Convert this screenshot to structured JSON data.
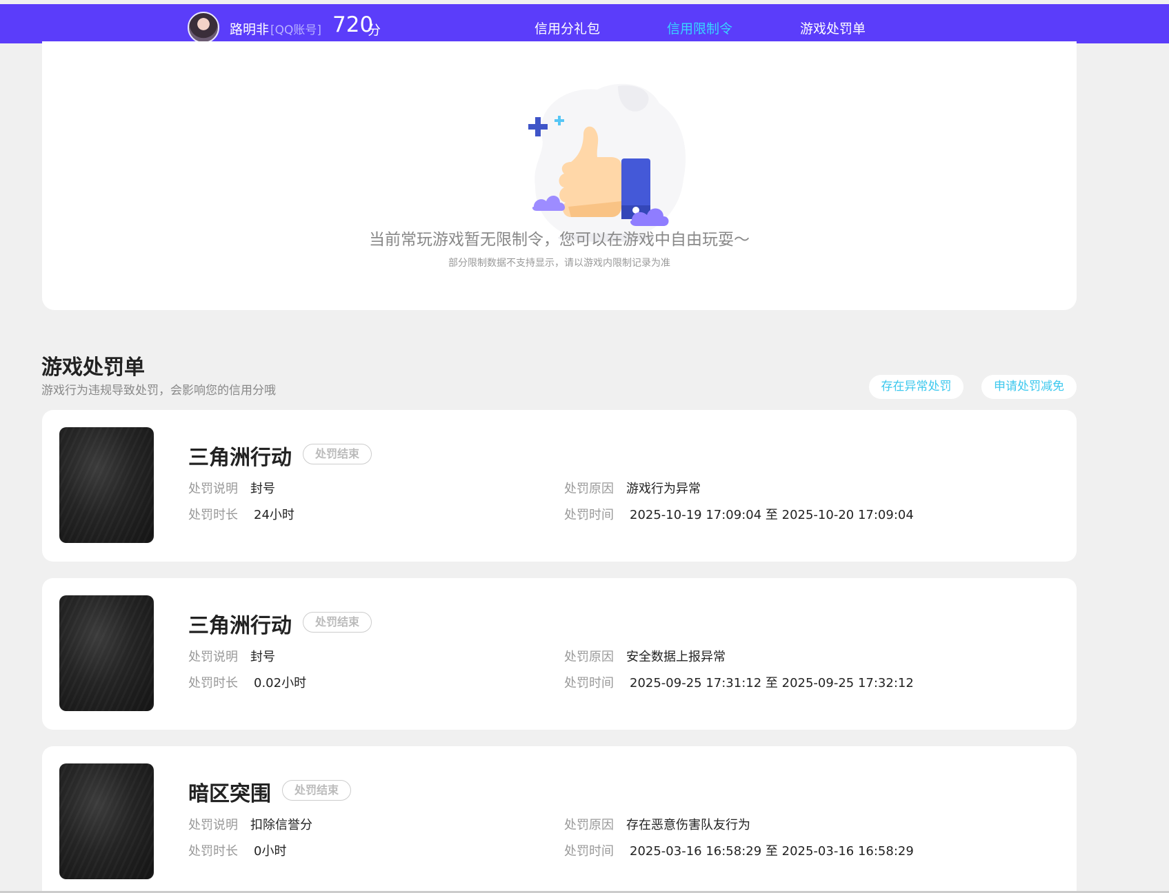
{
  "header": {
    "user_name": "路明非",
    "account_type": "[QQ账号]",
    "score": "720",
    "score_unit": "分",
    "nav": [
      {
        "label": "信用分礼包",
        "active": false
      },
      {
        "label": "信用限制令",
        "active": true
      },
      {
        "label": "游戏处罚单",
        "active": false
      }
    ]
  },
  "restriction": {
    "title": "当前常玩游戏暂无限制令，您可以在游戏中自由玩耍～",
    "subtitle": "部分限制数据不支持显示，请以游戏内限制记录为准"
  },
  "penalty_section": {
    "title": "游戏处罚单",
    "subtitle": "游戏行为违规导致处罚，会影响您的信用分哦",
    "btn_abnormal": "存在异常处罚",
    "btn_appeal": "申请处罚减免"
  },
  "labels": {
    "desc": "处罚说明",
    "duration": "处罚时长",
    "reason": "处罚原因",
    "time": "处罚时间"
  },
  "penalties": [
    {
      "game": "三角洲行动",
      "status": "处罚结束",
      "desc": "封号",
      "duration": "24小时",
      "reason": "游戏行为异常",
      "time": "2025-10-19 17:09:04 至 2025-10-20 17:09:04"
    },
    {
      "game": "三角洲行动",
      "status": "处罚结束",
      "desc": "封号",
      "duration": "0.02小时",
      "reason": "安全数据上报异常",
      "time": "2025-09-25 17:31:12 至 2025-09-25 17:32:12"
    },
    {
      "game": "暗区突围",
      "status": "处罚结束",
      "desc": "扣除信誉分",
      "duration": "0小时",
      "reason": "存在恶意伤害队友行为",
      "time": "2025-03-16 16:58:29 至 2025-03-16 16:58:29"
    }
  ],
  "colors": {
    "topbar": "#5b3dfa",
    "accent": "#37d6ff",
    "pill_text": "#3cc8ee"
  },
  "icons": {
    "illustration": "thumbs-up-illustration",
    "avatar": "avatar"
  }
}
